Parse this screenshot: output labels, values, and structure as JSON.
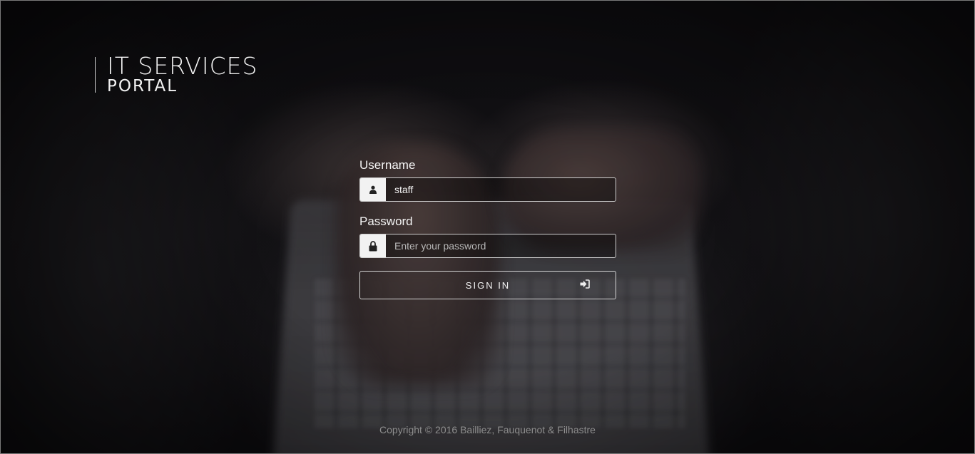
{
  "brand": {
    "title": "IT SERVICES",
    "subtitle": "PORTAL"
  },
  "login": {
    "username_label": "Username",
    "username_value": "staff",
    "password_label": "Password",
    "password_placeholder": "Enter your password",
    "signin_label": "SIGN IN"
  },
  "icons": {
    "username": "user-icon",
    "password": "lock-icon",
    "signin": "sign-in-icon"
  },
  "footer": {
    "copyright": "Copyright © 2016 Bailliez, Fauquenot & Filhastre"
  },
  "colors": {
    "text": "#f2f2f2",
    "addon_bg": "#f2f2f2",
    "footer_text": "#8e8e8e"
  }
}
